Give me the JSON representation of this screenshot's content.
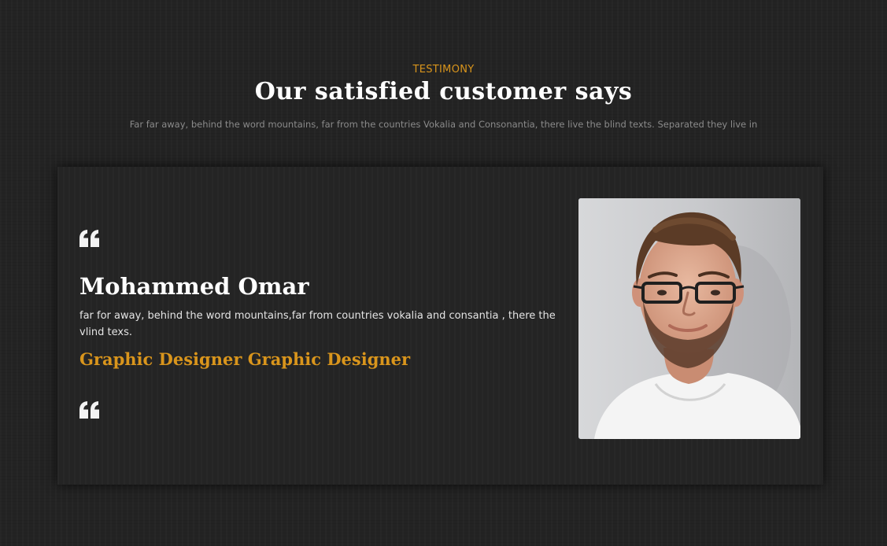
{
  "header": {
    "eyebrow": "TESTIMONY",
    "title": "Our satisfied customer says",
    "subtitle": "Far far away, behind the word mountains, far from the countries Vokalia and Consonantia, there live the blind texts. Separated they live in"
  },
  "testimonial": {
    "name": "Mohammed Omar",
    "text": "far for away, behind the word mountains,far from countries vokalia and consantia , there the vlind texs.",
    "role": "Graphic Designer Graphic Designer",
    "icons": {
      "quote_top": "quote-icon",
      "quote_bottom": "quote-icon",
      "photo": "person-photo"
    }
  },
  "colors": {
    "background": "#232323",
    "accent": "#d9951c",
    "heading": "#ffffff",
    "body_text": "#e4e4e4",
    "muted_text": "#8a8a8a"
  }
}
